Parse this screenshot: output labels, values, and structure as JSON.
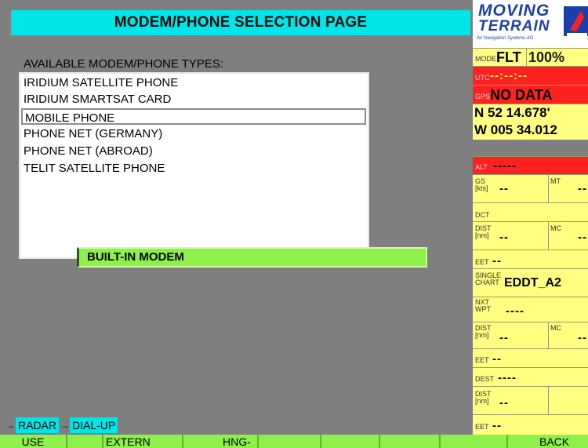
{
  "page": {
    "title": "MODEM/PHONE SELECTION PAGE",
    "section_label": "AVAILABLE MODEM/PHONE TYPES:"
  },
  "modem_list": {
    "items": [
      "IRIDIUM SATELLITE PHONE",
      "IRIDIUM SMARTSAT CARD",
      "MOBILE PHONE",
      "PHONE NET (GERMANY)",
      "PHONE NET (ABROAD)",
      "TELIT SATELLITE PHONE"
    ],
    "selected_index": 2
  },
  "current_modem": "BUILT-IN MODEM",
  "path": {
    "arrow": "→",
    "segments": [
      "RADAR",
      "DIAL-UP"
    ]
  },
  "softkeys": [
    "USE",
    "",
    "EXTERN",
    "HNG-UP",
    "",
    "",
    "",
    "",
    "BACK"
  ],
  "logo": {
    "line1": "MOVING",
    "line2": "TERRAIN",
    "tagline": "Air Navigation Systems AG"
  },
  "status": {
    "mode_label": "MODE",
    "mode_value": "FLT",
    "mode_pct": "100%",
    "utc_label": "UTC",
    "utc_value": "--:--:--",
    "gps_label": "GPS",
    "gps_value": "NO DATA",
    "lat": "N 52 14.678'",
    "lon": "W 005 34.012",
    "alt_label": "ALT",
    "alt_value": "-----",
    "gs_label": "GS",
    "gs_unit": "[kts]",
    "gs_value": "--",
    "mt_label": "MT",
    "mt_value": "--",
    "dct_label": "DCT",
    "dist_label": "DIST",
    "dist_unit": "[nm]",
    "dist_value": "--",
    "mc_label": "MC",
    "mc_value": "--",
    "eet_label": "EET",
    "eet_value": "--",
    "chart_label1": "SINGLE",
    "chart_label2": "CHART",
    "chart_value": "EDDT_A2",
    "nxt_label1": "NXT",
    "nxt_label2": "WPT",
    "nxt_value": "----",
    "dist2_value": "--",
    "mc2_value": "--",
    "eet2_value": "--",
    "dest_label": "DEST",
    "dest_value": "----",
    "dist3_value": "--",
    "eet3_value": "--"
  },
  "colors": {
    "background": "#7f7f7f",
    "title_bar": "#00e5e8",
    "highlight_green": "#8ef04a",
    "panel_yellow": "#ffff80",
    "alert_red": "#ff2020",
    "logo_blue": "#1c3fae"
  }
}
